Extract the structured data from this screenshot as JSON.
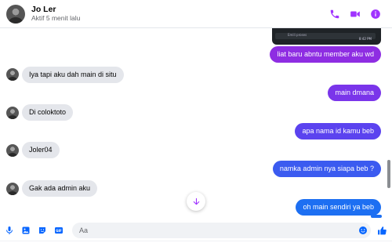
{
  "header": {
    "name": "Jo Ler",
    "status": "Aktif 5 menit lalu"
  },
  "colors": {
    "accent": "#a033ff",
    "out_purple": "#8e2de2",
    "out_violet": "#6a3df0",
    "out_blue": "#3b5bf0",
    "out_blue_bright": "#1d6ff2",
    "incoming": "#e4e6eb"
  },
  "icons": {
    "phone": "phone-icon",
    "video": "video-icon",
    "info": "info-icon",
    "mic": "microphone-icon",
    "image": "image-icon",
    "sticker": "sticker-icon",
    "gif": "gif-icon",
    "emoji": "emoji-icon",
    "like": "thumbs-up-icon",
    "scroll_down": "arrow-down-icon"
  },
  "media_preview": {
    "mini_text": "Emili proses",
    "mini_time": "8:42 PM"
  },
  "messages": [
    {
      "side": "out",
      "text": "liat baru abntu member aku wd"
    },
    {
      "side": "in",
      "text": "Iya tapi aku dah main di situ"
    },
    {
      "side": "out",
      "text": "main dmana"
    },
    {
      "side": "in",
      "text": "Di coloktoto"
    },
    {
      "side": "out",
      "text": "apa nama id kamu beb"
    },
    {
      "side": "in",
      "text": "Joler04"
    },
    {
      "side": "out",
      "text": "namka admin nya siapa beb ?"
    },
    {
      "side": "in",
      "text": "Gak ada admin aku"
    },
    {
      "side": "out",
      "text": "oh main sendiri ya beb"
    }
  ],
  "composer": {
    "placeholder": "Aa",
    "gif_label": "GIF"
  }
}
